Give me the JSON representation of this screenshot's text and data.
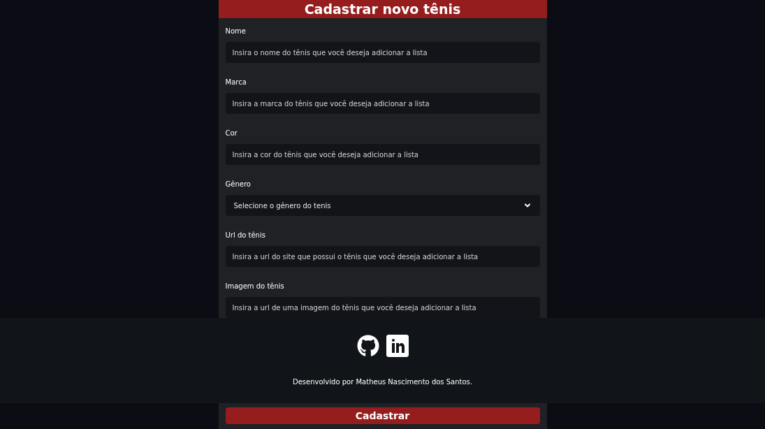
{
  "form": {
    "title": "Cadastrar novo tênis",
    "fields": [
      {
        "kind": "text",
        "label": "Nome",
        "placeholder": "Insira o nome do tênis que você deseja adicionar a lista"
      },
      {
        "kind": "text",
        "label": "Marca",
        "placeholder": "Insira a marca do tênis que você deseja adicionar a lista"
      },
      {
        "kind": "text",
        "label": "Cor",
        "placeholder": "Insira a cor do tênis que você deseja adicionar a lista"
      },
      {
        "kind": "select",
        "label": "Gênero",
        "value": "Selecione o gênero do tenis"
      },
      {
        "kind": "text",
        "label": "Url do tênis",
        "placeholder": "Insira a url do site que possui o tênis que você deseja adicionar a lista"
      },
      {
        "kind": "text",
        "label": "Imagem do tênis",
        "placeholder": "Insira a url de uma imagem do tênis que você deseja adicionar a lista"
      }
    ],
    "submit": "Cadastrar"
  },
  "footer": {
    "credit": "Desenvolvido por Matheus Nascimento dos Santos."
  }
}
